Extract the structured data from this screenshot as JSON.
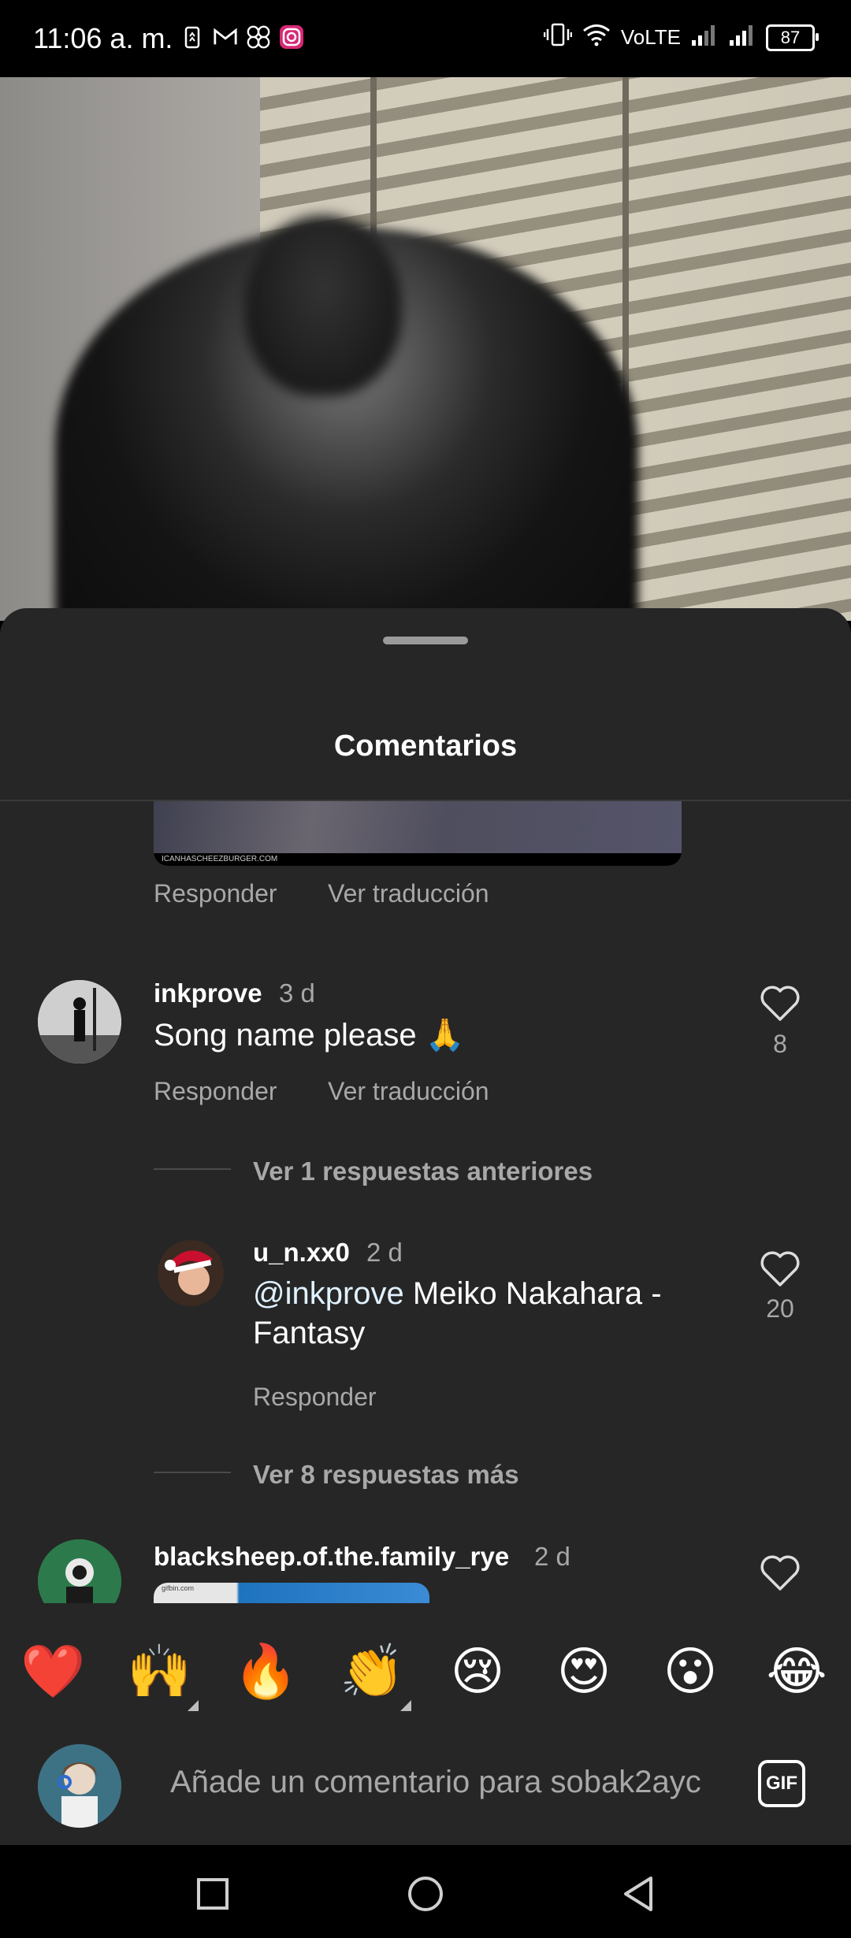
{
  "status_bar": {
    "time": "11:06 a. m.",
    "network_label": "VoLTE",
    "battery": "87",
    "left_icons": [
      "battery-saver-icon",
      "gmail-icon",
      "pinwheel-icon",
      "instagram-icon"
    ],
    "right_icons": [
      "vibrate-icon",
      "wifi-icon",
      "signal-icon",
      "signal-icon"
    ]
  },
  "sheet": {
    "title": "Comentarios"
  },
  "comments": {
    "partial_actions": {
      "reply": "Responder",
      "translate": "Ver traducción",
      "media_caption": "ICANHASCHEEZBURGER.COM"
    },
    "c1": {
      "user": "inkprove",
      "time": "3 d",
      "text": "Song name please 🙏",
      "likes": "8",
      "reply": "Responder",
      "translate": "Ver traducción",
      "view_previous": "Ver 1 respuestas anteriores"
    },
    "r1": {
      "user": "u_n.xx0",
      "time": "2 d",
      "mention": "@inkprove",
      "text": " Meiko Nakahara - Fantasy",
      "likes": "20",
      "reply": "Responder"
    },
    "view_more": "Ver 8 respuestas más",
    "c2": {
      "user": "blacksheep.of.the.family_rye",
      "time": "2 d",
      "gif_label": "gifbin.com"
    }
  },
  "emoji_bar": [
    "❤️",
    "🙌",
    "🔥",
    "👏",
    "😢",
    "😍",
    "😮",
    "😂"
  ],
  "input": {
    "placeholder": "Añade un comentario para sobak2ayc",
    "gif_label": "GIF"
  },
  "colors": {
    "sheet_bg": "#262626",
    "secondary_text": "#a8a8a8",
    "heart_red": "#e0245e"
  }
}
